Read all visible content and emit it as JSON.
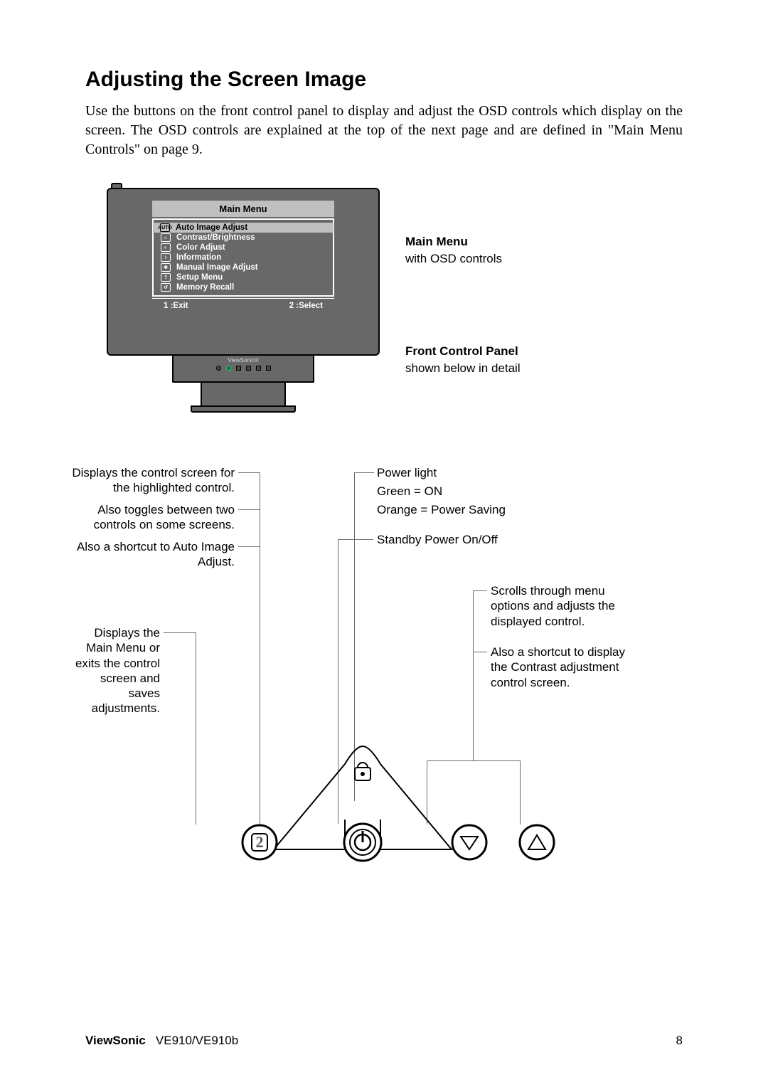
{
  "heading": "Adjusting the Screen Image",
  "para": "Use the buttons on the front control panel to display and adjust the OSD controls which display on the screen. The OSD controls are explained at the top of the next page and are defined in \"Main Menu Controls\" on page 9.",
  "osd": {
    "title": "Main Menu",
    "items": [
      {
        "ico": "AUTO",
        "label": "Auto Image Adjust",
        "selected": true
      },
      {
        "ico": "☼",
        "label": "Contrast/Brightness"
      },
      {
        "ico": "◐",
        "label": "Color Adjust"
      },
      {
        "ico": "i",
        "label": "Information"
      },
      {
        "ico": "✥",
        "label": "Manual Image Adjust"
      },
      {
        "ico": "?",
        "label": "Setup Menu"
      },
      {
        "ico": "↺",
        "label": "Memory Recall"
      }
    ],
    "foot_left": "1 :Exit",
    "foot_right": "2 :Select",
    "brand": "ViewSonic"
  },
  "side": {
    "mm_h": "Main Menu",
    "mm_t": "with OSD controls",
    "fp_h": "Front Control Panel",
    "fp_t": "shown below in detail"
  },
  "callouts": {
    "c1a": "Displays the control screen for the highlighted control.",
    "c1b": "Also toggles between two controls on some screens.",
    "c1c": "Also a shortcut to Auto Image Adjust.",
    "c2": "Displays the Main Menu or exits the control screen and saves adjustments.",
    "power_a": "Power light",
    "power_b": "Green = ON",
    "power_c": "Orange = Power Saving",
    "standby": "Standby Power On/Off",
    "scroll_a": "Scrolls through menu options and adjusts the displayed control.",
    "scroll_b": "Also a shortcut to display the Contrast adjustment control screen."
  },
  "footer": {
    "brand": "ViewSonic",
    "model": "VE910/VE910b",
    "page": "8"
  }
}
